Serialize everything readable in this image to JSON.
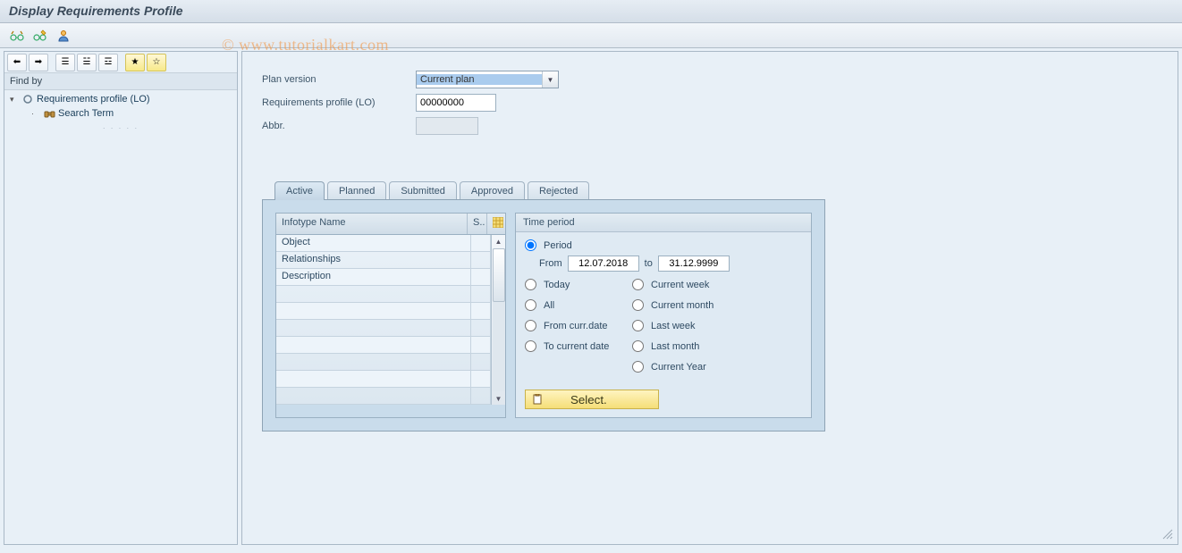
{
  "title": "Display Requirements Profile",
  "watermark": "© www.tutorialkart.com",
  "left": {
    "findby": "Find by",
    "tree": {
      "root_label": "Requirements profile (LO)",
      "child_label": "Search Term"
    }
  },
  "form": {
    "plan_version_label": "Plan version",
    "plan_version_value": "Current plan",
    "req_profile_label": "Requirements profile (LO)",
    "req_profile_value": "00000000",
    "abbr_label": "Abbr.",
    "abbr_value": ""
  },
  "tabs": [
    "Active",
    "Planned",
    "Submitted",
    "Approved",
    "Rejected"
  ],
  "active_tab": "Active",
  "infotype": {
    "header_name": "Infotype Name",
    "header_s": "S..",
    "rows": [
      "Object",
      "Relationships",
      "Description",
      "",
      "",
      "",
      "",
      "",
      "",
      ""
    ]
  },
  "time": {
    "title": "Time period",
    "period": "Period",
    "from_label": "From",
    "from_value": "12.07.2018",
    "to_label": "to",
    "to_value": "31.12.9999",
    "today": "Today",
    "all": "All",
    "from_curr": "From curr.date",
    "to_curr": "To current date",
    "curr_week": "Current week",
    "curr_month": "Current month",
    "last_week": "Last week",
    "last_month": "Last month",
    "curr_year": "Current Year",
    "select_btn": "Select."
  }
}
